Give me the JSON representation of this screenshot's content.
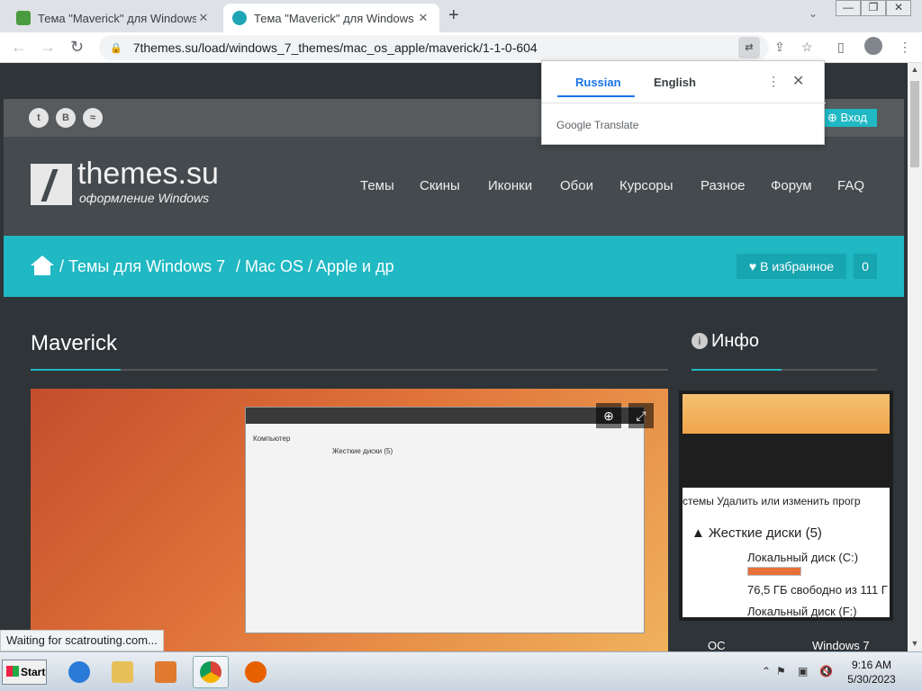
{
  "tabs": [
    {
      "title": "Тема \"Maverick\" для Windows",
      "close": "✕"
    },
    {
      "title": "Тема \"Maverick\" для Windows",
      "close": "✕"
    }
  ],
  "new_tab": "+",
  "tab_dropdown": "⌄",
  "window_controls": {
    "minimize": "—",
    "maximize": "❐",
    "close": "✕"
  },
  "toolbar": {
    "back": "←",
    "forward": "→",
    "reload": "↻",
    "lock": "🔒",
    "url": "7themes.su/load/windows_7_themes/mac_os_apple/maverick/1-1-0-604",
    "translate_icon": "⇄",
    "share": "⇪",
    "bookmark": "☆",
    "sidepanel": "▯",
    "menu": "⋮"
  },
  "site": {
    "social": [
      "t",
      "B",
      "≈"
    ],
    "login": "⊕ Вход",
    "logo_text": "themes.su",
    "logo_sub": "оформление Windows",
    "menu": [
      "Темы",
      "Скины",
      "Иконки",
      "Обои",
      "Курсоры",
      "Разное",
      "Форум",
      "FAQ"
    ],
    "breadcrumb": [
      "/ Темы для Windows 7",
      "/ Mac OS",
      "/ Apple и др"
    ],
    "fav_button": "♥ В избранное",
    "fav_count": "0",
    "page_title": "Maverick",
    "info_title": "Инфо",
    "info_icon": "i"
  },
  "preview": {
    "window_label": "Компьютер",
    "section_label": "Жесткие диски (5)",
    "zoom_in": "⊕",
    "expand": "⤢"
  },
  "side_preview": {
    "command_strip": "стемы    Удалить или изменить прогр",
    "section": "▲ Жесткие диски (5)",
    "disk_c": "Локальный диск (C:)",
    "free_c": "76,5 ГБ свободно из 111 Г",
    "disk_f": "Локальный диск (F:)"
  },
  "side_row": {
    "left": "ОС",
    "right": "Windows 7"
  },
  "status_text": "Waiting for scatrouting.com...",
  "translate_popup": {
    "lang_selected": "Russian",
    "lang_other": "English",
    "menu": "⋮",
    "close": "✕",
    "brand": "Google Translate"
  },
  "taskbar": {
    "start": "Start",
    "tray": [
      "⌃",
      "⚑",
      "▣",
      "🔇"
    ],
    "time": "9:16 AM",
    "date": "5/30/2023"
  },
  "colors": {
    "accent": "#1fb8c3",
    "header": "#444a4d",
    "topbar": "#575b5e"
  }
}
